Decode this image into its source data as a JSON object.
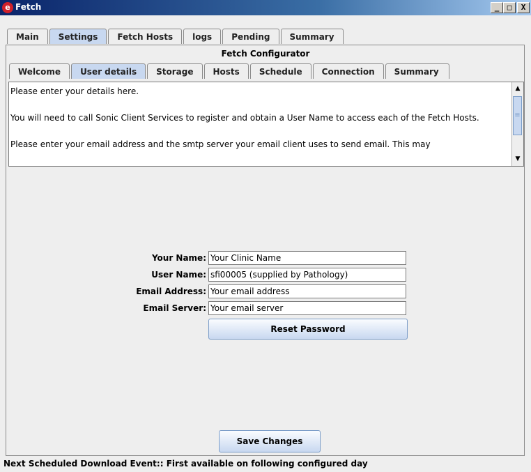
{
  "window": {
    "title": "Fetch",
    "minimize": "_",
    "maximize": "□",
    "close": "X"
  },
  "top_tabs": [
    "Main",
    "Settings",
    "Fetch Hosts",
    "logs",
    "Pending",
    "Summary"
  ],
  "top_tab_active": "Settings",
  "panel_title": "Fetch Configurator",
  "sub_tabs": [
    "Welcome",
    "User details",
    "Storage",
    "Hosts",
    "Schedule",
    "Connection",
    "Summary"
  ],
  "sub_tab_active": "User details",
  "instructions": [
    "Please enter your details here.",
    "",
    "You will need to call Sonic Client Services to register and obtain a User Name to access each of the Fetch Hosts.",
    "",
    "Please enter your email address and the smtp server your email client uses to send email. This may"
  ],
  "form": {
    "your_name": {
      "label": "Your Name:",
      "value": "Your Clinic Name"
    },
    "user_name": {
      "label": "User Name:",
      "value": "sfi00005 (supplied by Pathology)"
    },
    "email_address": {
      "label": "Email Address:",
      "value": "Your email address"
    },
    "email_server": {
      "label": "Email Server:",
      "value": "Your email server"
    },
    "reset_password": "Reset Password"
  },
  "save_changes": "Save Changes",
  "status": "Next Scheduled Download Event:: First available on following configured day",
  "colors": {
    "titlebar": "#0a246a",
    "tab_active": "#c8d8f0",
    "background": "#eeeeee"
  }
}
